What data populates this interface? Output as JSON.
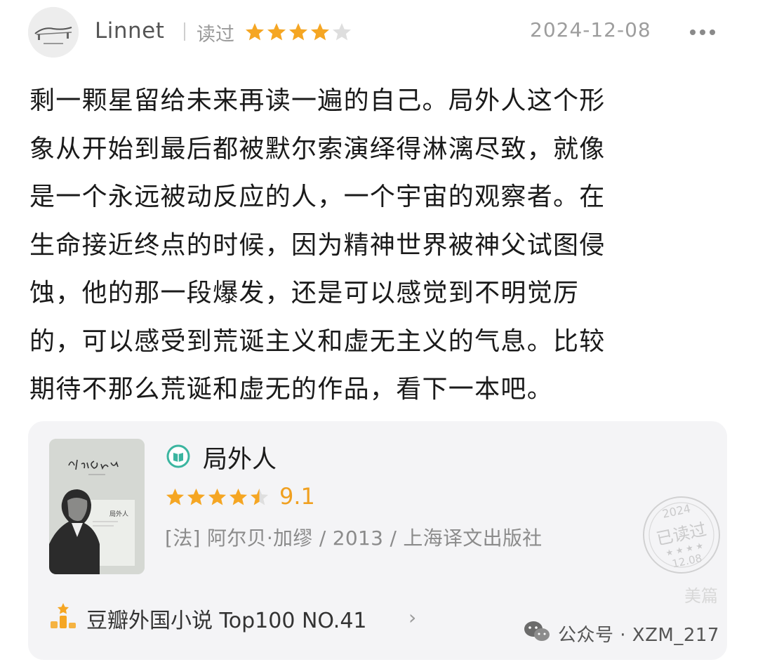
{
  "header": {
    "username": "Linnet",
    "read_label": "读过",
    "rating": 4,
    "rating_max": 5,
    "date": "2024-12-08"
  },
  "review": {
    "lines": [
      "剩一颗星留给未来再读一遍的自己。局外人这个形",
      "象从开始到最后都被默尔索演绎得淋漓尽致，就像",
      "是一个永远被动反应的人，一个宇宙的观察者。在",
      "生命接近终点的时候，因为精神世界被神父试图侵",
      "蚀，他的那一段爆发，还是可以感觉到不明觉厉",
      "的，可以感受到荒诞主义和虚无主义的气息。比较",
      "期待不那么荒诞和虚无的作品，看下一本吧。"
    ]
  },
  "book": {
    "title": "局外人",
    "rating_stars": 4.5,
    "score": "9.1",
    "meta": "[法] 阿尔贝·加缪 / 2013 / 上海译文出版社",
    "cover_author_script": "Albert Camus",
    "cover_title": "局外人",
    "stamp": {
      "year": "2024",
      "label": "已读过",
      "date": "12.08"
    },
    "rank": "豆瓣外国小说 Top100 NO.41",
    "rank_chevron": "›"
  },
  "watermark": {
    "text": "公众号 · XZM_217",
    "brand": "美篇"
  },
  "colors": {
    "star": "#f5a623",
    "star_empty": "#dedede",
    "ebook_icon": "#3bb5a0",
    "card_bg": "#f4f4f6"
  },
  "icons": [
    "more-dots-icon",
    "ebook-icon",
    "rank-icon",
    "wechat-icon",
    "star-icon"
  ]
}
